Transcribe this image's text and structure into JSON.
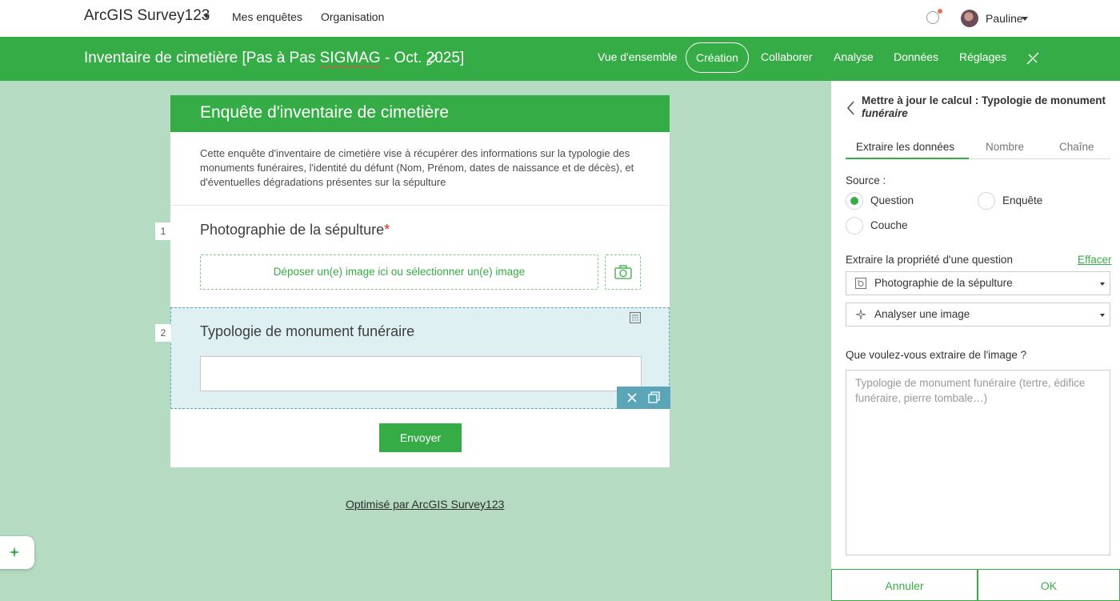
{
  "topbar": {
    "brand": "ArcGIS Survey123",
    "links": [
      "Mes enquêtes",
      "Organisation"
    ],
    "user": "Pauline"
  },
  "greenbar": {
    "title_before": "Inventaire de cimetière [Pas à Pas ",
    "title_underlined": "SIGMAG",
    "title_after": " - Oct. 2025]",
    "nav": [
      "Vue d'ensemble",
      "Création",
      "Collaborer",
      "Analyse",
      "Données",
      "Réglages"
    ],
    "active_tab": "Création"
  },
  "form": {
    "header": "Enquête d'inventaire de cimetière",
    "description": "Cette enquête d'inventaire de cimetière vise à récupérer des informations sur la typologie des monuments funéraires, l'identité du défunt (Nom, Prénom, dates de naissance et de décès), et d'éventuelles dégradations présentes sur la sépulture",
    "questions": [
      {
        "number": "1",
        "label": "Photographie de la sépulture",
        "required_mark": "*",
        "dropzone": "Déposer un(e) image ici ou sélectionner un(e) image"
      },
      {
        "number": "2",
        "label": "Typologie de monument funéraire"
      }
    ],
    "submit": "Envoyer",
    "powered_by": "Optimisé par ArcGIS Survey123"
  },
  "panel": {
    "title_main": "Mettre à jour le calcul : Typologie de monument ",
    "title_sub": "funéraire",
    "tabs": [
      "Extraire les données",
      "Nombre",
      "Chaîne"
    ],
    "source_label": "Source :",
    "source_options": [
      "Question",
      "Enquête",
      "Couche"
    ],
    "source_selected": "Question",
    "extract_label": "Extraire la propriété d'une question",
    "clear": "Effacer",
    "question_select": "Photographie de la sépulture",
    "action_select": "Analyser une image",
    "prompt_label": "Que voulez-vous extraire de l'image ?",
    "prompt_placeholder": "Typologie de monument funéraire (tertre, édifice funéraire, pierre tombale…)",
    "cancel": "Annuler",
    "ok": "OK"
  },
  "colors": {
    "green": "#35ac46",
    "background": "#b5dcc2",
    "selected_question": "#def0f2",
    "toolbar_blue": "#5aa5b8"
  }
}
